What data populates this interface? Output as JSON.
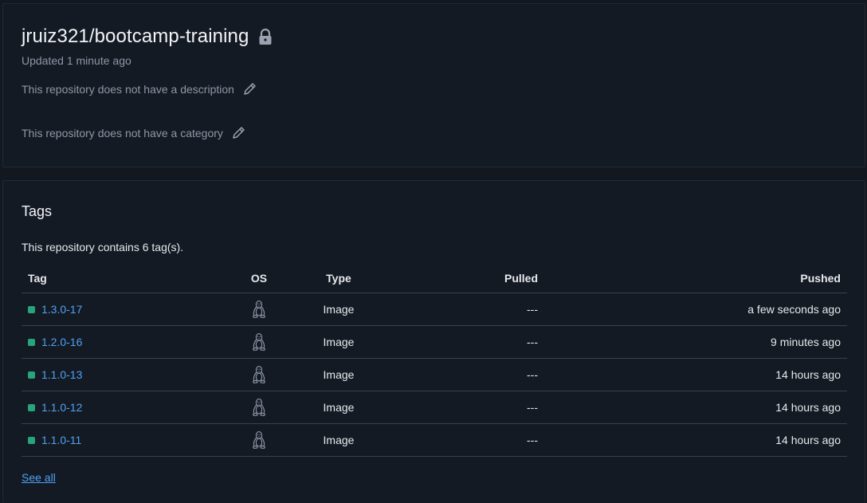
{
  "repo": {
    "name": "jruiz321/bootcamp-training",
    "updated": "Updated 1 minute ago",
    "description": "This repository does not have a description",
    "category": "This repository does not have a category"
  },
  "tags_section": {
    "heading": "Tags",
    "count_text": "This repository contains 6 tag(s).",
    "columns": {
      "tag": "Tag",
      "os": "OS",
      "type": "Type",
      "pulled": "Pulled",
      "pushed": "Pushed"
    },
    "rows": [
      {
        "tag": "1.3.0-17",
        "os_icon": "linux-icon",
        "type": "Image",
        "pulled": "---",
        "pushed": "a few seconds ago"
      },
      {
        "tag": "1.2.0-16",
        "os_icon": "linux-icon",
        "type": "Image",
        "pulled": "---",
        "pushed": "9 minutes ago"
      },
      {
        "tag": "1.1.0-13",
        "os_icon": "linux-icon",
        "type": "Image",
        "pulled": "---",
        "pushed": "14 hours ago"
      },
      {
        "tag": "1.1.0-12",
        "os_icon": "linux-icon",
        "type": "Image",
        "pulled": "---",
        "pushed": "14 hours ago"
      },
      {
        "tag": "1.1.0-11",
        "os_icon": "linux-icon",
        "type": "Image",
        "pulled": "---",
        "pushed": "14 hours ago"
      }
    ],
    "see_all": "See all"
  },
  "colors": {
    "accent_link": "#4ea1f3",
    "status_dot": "#27a47c",
    "background": "#13171f"
  },
  "icons": {
    "private": "lock-icon",
    "edit": "pencil-icon"
  }
}
